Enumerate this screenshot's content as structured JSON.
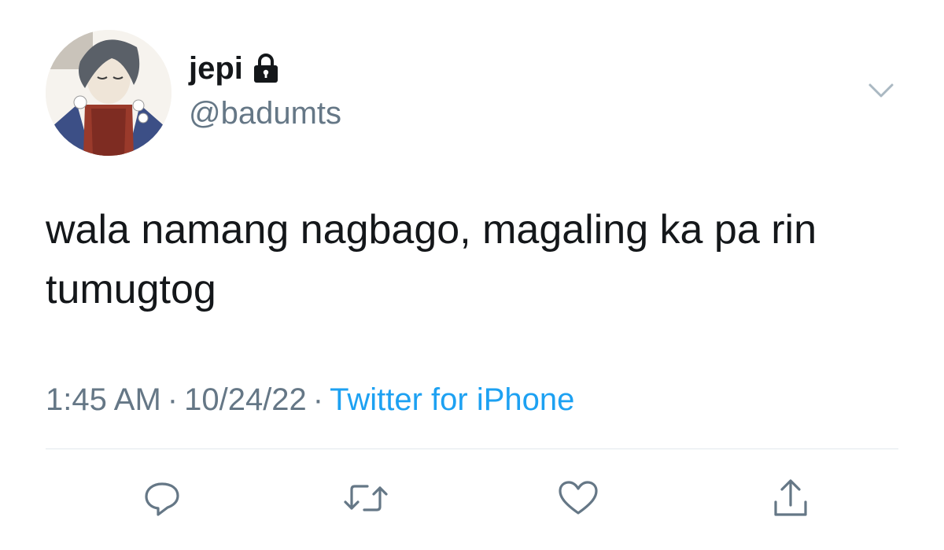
{
  "author": {
    "name": "jepi",
    "handle": "@badumts",
    "protected": true,
    "avatar_icon": "avatar-illustration"
  },
  "tweet": {
    "text": "wala namang nagbago, magaling ka pa rin tumugtog",
    "time": "1:45 AM",
    "separator": "·",
    "date": "10/24/22",
    "source": "Twitter for iPhone"
  },
  "icons": {
    "more": "chevron-down-icon",
    "lock": "lock-icon",
    "reply": "reply-icon",
    "retweet": "retweet-icon",
    "like": "heart-icon",
    "share": "share-icon"
  },
  "colors": {
    "text": "#14171a",
    "secondary": "#657786",
    "link": "#1da1f2",
    "divider": "#e1e8ed",
    "icon": "#657786"
  }
}
